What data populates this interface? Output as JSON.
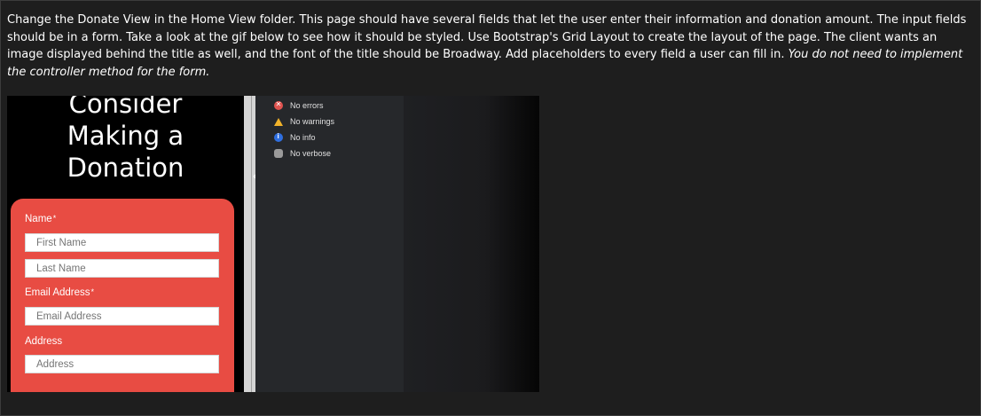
{
  "instructions": {
    "main": "Change the Donate View in the Home View folder.  This page should have several fields that let the user enter their information and donation amount.  The input fields should be in a form.  Take a look at the gif below to see how it should be styled.  Use Bootstrap's Grid Layout to create the layout of the page. The client wants an image displayed behind the title as well, and the font of the title should be Broadway. Add placeholders to every field a user can fill in.",
    "italic": "You do not need to implement the controller method for the form."
  },
  "preview": {
    "title_line1": "Consider",
    "title_line2": "Making a",
    "title_line3": "Donation",
    "form": {
      "name_label": "Name",
      "required_mark": "*",
      "first_name_placeholder": "First Name",
      "last_name_placeholder": "Last Name",
      "email_label": "Email Address",
      "email_placeholder": "Email Address",
      "address_label": "Address",
      "address_placeholder": "Address"
    },
    "card_color": "#e84c43"
  },
  "devtools": {
    "errors": "No errors",
    "warnings": "No warnings",
    "info": "No info",
    "verbose": "No verbose"
  },
  "icons": [
    "error-icon",
    "warning-icon",
    "info-icon",
    "verbose-icon",
    "resize-cursor-icon"
  ]
}
